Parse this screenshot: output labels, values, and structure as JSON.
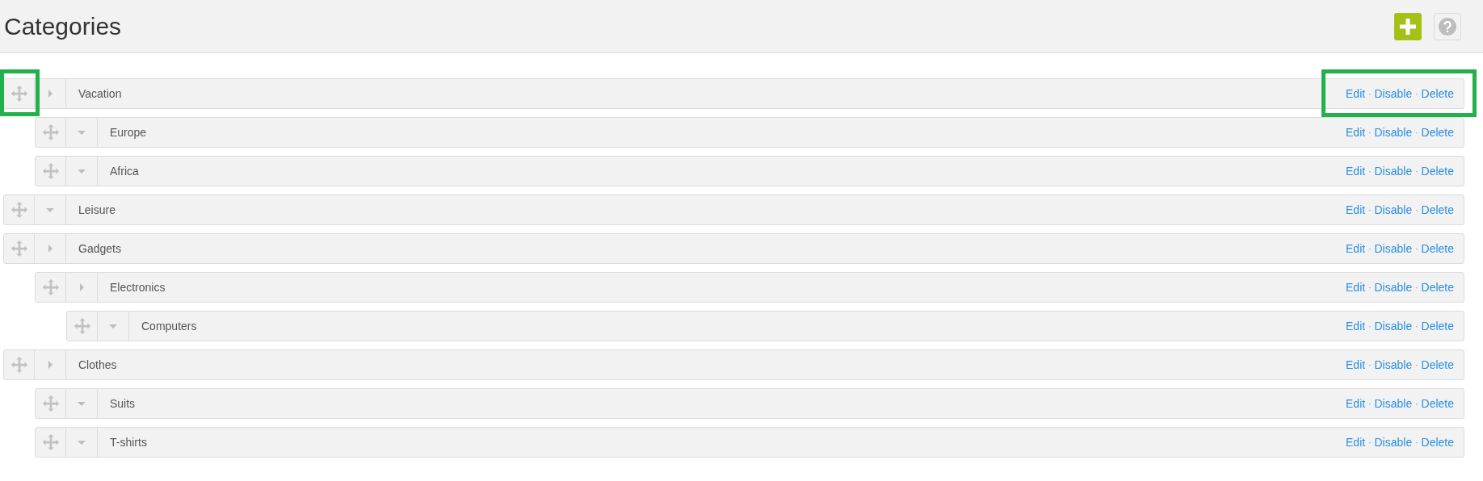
{
  "header": {
    "title": "Categories"
  },
  "categories": [
    {
      "name": "Vacation",
      "expanded": false,
      "highlighted": true,
      "actions": [
        "Edit",
        "Disable",
        "Delete"
      ],
      "separator": "·",
      "children": [
        {
          "name": "Europe",
          "expanded": true,
          "highlighted": false,
          "actions": [
            "Edit",
            "Disable",
            "Delete"
          ],
          "separator": "·"
        },
        {
          "name": "Africa",
          "expanded": true,
          "highlighted": false,
          "actions": [
            "Edit",
            "Disable",
            "Delete"
          ],
          "separator": "·"
        }
      ]
    },
    {
      "name": "Leisure",
      "expanded": true,
      "highlighted": false,
      "actions": [
        "Edit",
        "Disable",
        "Delete"
      ],
      "separator": "·"
    },
    {
      "name": "Gadgets",
      "expanded": false,
      "highlighted": false,
      "actions": [
        "Edit",
        "Disable",
        "Delete"
      ],
      "separator": "·",
      "children": [
        {
          "name": "Electronics",
          "expanded": false,
          "highlighted": false,
          "actions": [
            "Edit",
            "Disable",
            "Delete"
          ],
          "separator": "·",
          "children": [
            {
              "name": "Computers",
              "expanded": true,
              "highlighted": false,
              "actions": [
                "Edit",
                "Disable",
                "Delete"
              ],
              "separator": "·"
            }
          ]
        }
      ]
    },
    {
      "name": "Clothes",
      "expanded": false,
      "highlighted": false,
      "actions": [
        "Edit",
        "Disable",
        "Delete"
      ],
      "separator": "·",
      "children": [
        {
          "name": "Suits",
          "expanded": true,
          "highlighted": false,
          "actions": [
            "Edit",
            "Disable",
            "Delete"
          ],
          "separator": "·"
        },
        {
          "name": "T-shirts",
          "expanded": true,
          "highlighted": false,
          "actions": [
            "Edit",
            "Disable",
            "Delete"
          ],
          "separator": "·"
        }
      ]
    }
  ]
}
